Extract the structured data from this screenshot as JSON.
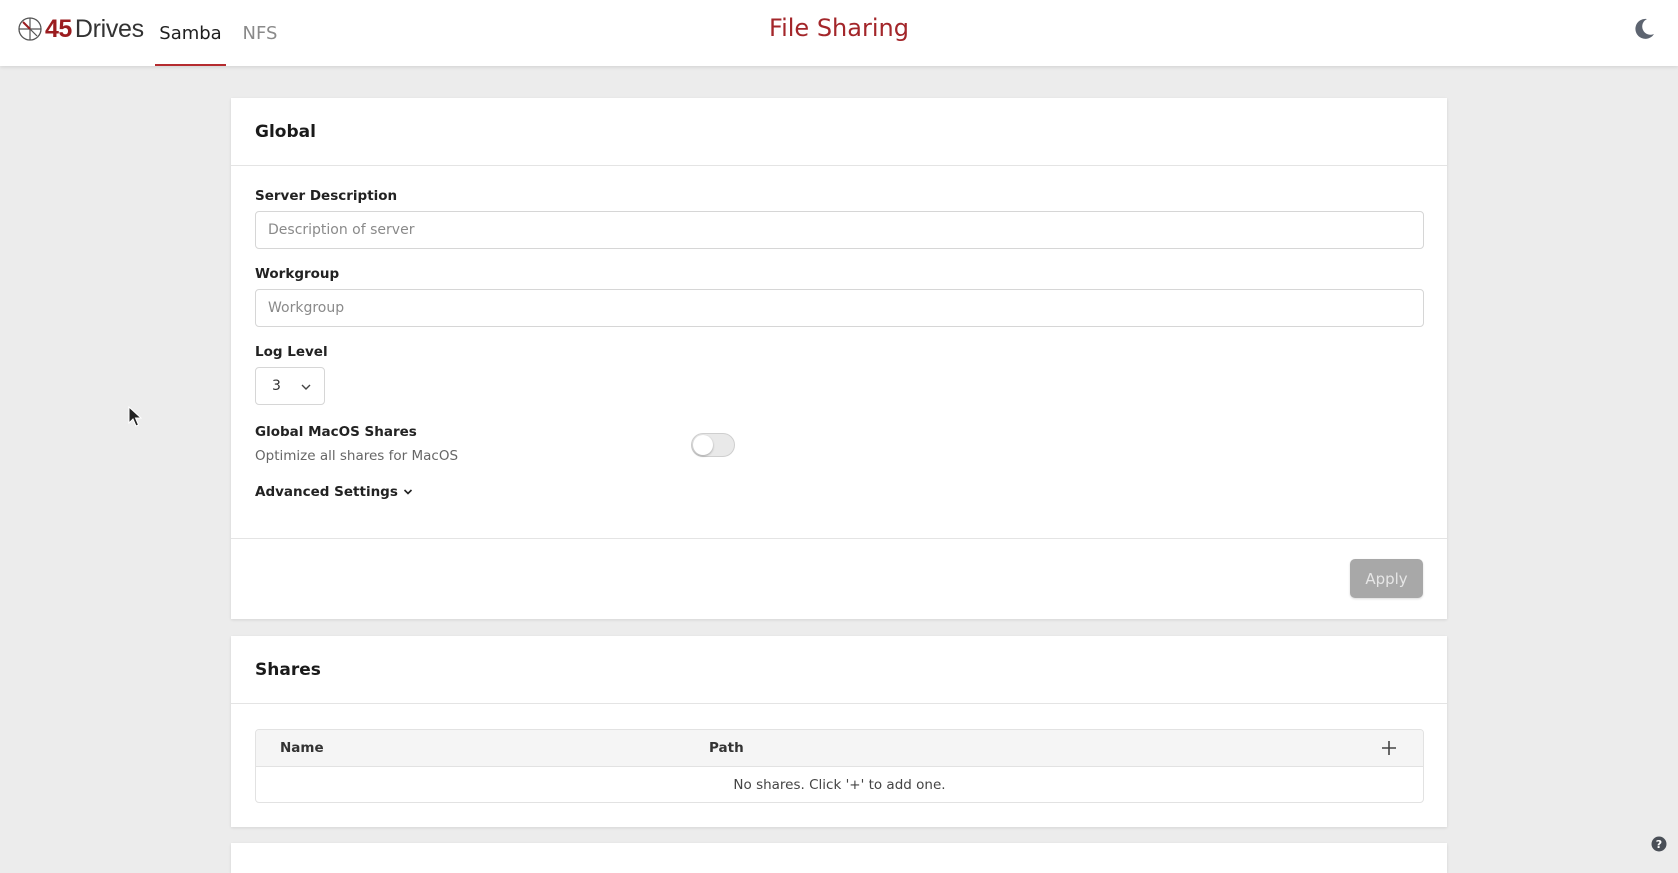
{
  "header": {
    "logo_number": "45",
    "logo_text": "Drives",
    "tabs": [
      {
        "label": "Samba",
        "active": true
      },
      {
        "label": "NFS",
        "active": false
      }
    ],
    "title": "File Sharing",
    "theme_icon": "moon-icon"
  },
  "global": {
    "title": "Global",
    "server_description": {
      "label": "Server Description",
      "placeholder": "Description of server",
      "value": ""
    },
    "workgroup": {
      "label": "Workgroup",
      "placeholder": "Workgroup",
      "value": ""
    },
    "log_level": {
      "label": "Log Level",
      "value": "3"
    },
    "macos": {
      "label": "Global MacOS Shares",
      "description": "Optimize all shares for MacOS",
      "enabled": false
    },
    "advanced_label": "Advanced Settings",
    "apply_label": "Apply"
  },
  "shares": {
    "title": "Shares",
    "columns": [
      "Name",
      "Path"
    ],
    "add_label": "+",
    "empty_text": "No shares. Click '+' to add one."
  },
  "colors": {
    "brand": "#9b1c1f",
    "title": "#a3262a",
    "tab_underline": "#b52b2f",
    "background": "#ececec",
    "apply_disabled": "#a8a8a8"
  }
}
